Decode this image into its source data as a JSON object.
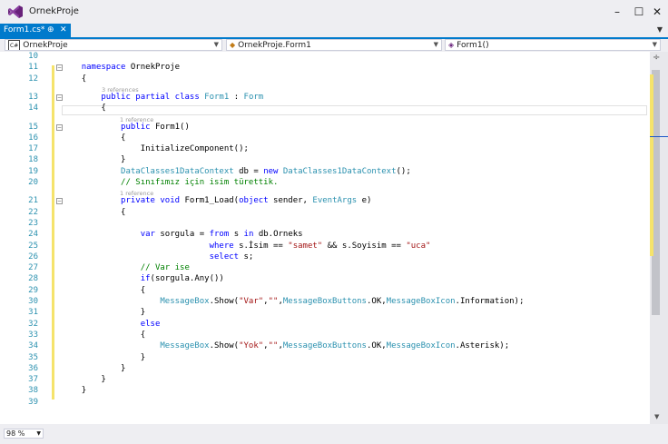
{
  "app": {
    "title": "OrnekProje"
  },
  "window_controls": {
    "minimize": "–",
    "maximize": "☐",
    "close": "✕"
  },
  "tabs": [
    {
      "label": "Form1.cs*",
      "pin": "⊕",
      "close": "✕"
    }
  ],
  "nav": {
    "project": "OrnekProje",
    "class": "OrnekProje.Form1",
    "member": "Form1()"
  },
  "zoom": "98 %",
  "lines": [
    {
      "n": "10",
      "html": ""
    },
    {
      "n": "11",
      "html": "    <span class='kw'>namespace</span> <span class='tx'>OrnekProje</span>"
    },
    {
      "n": "12",
      "html": "    <span class='tx'>{</span>"
    },
    {
      "n": "13",
      "html": "        <span class='kw'>public</span> <span class='kw'>partial</span> <span class='kw'>class</span> <span class='ty'>Form1</span> <span class='tx'>:</span> <span class='ty'>Form</span>"
    },
    {
      "n": "14",
      "html": "        <span class='tx'>{</span>"
    },
    {
      "n": "15",
      "html": "            <span class='kw'>public</span> <span class='tx'>Form1()</span>"
    },
    {
      "n": "16",
      "html": "            <span class='tx'>{</span>"
    },
    {
      "n": "17",
      "html": "                <span class='tx'>InitializeComponent();</span>"
    },
    {
      "n": "18",
      "html": "            <span class='tx'>}</span>"
    },
    {
      "n": "19",
      "html": "            <span class='ty'>DataClasses1DataContext</span> <span class='tx'>db =</span> <span class='kw'>new</span> <span class='ty'>DataClasses1DataContext</span><span class='tx'>();</span>"
    },
    {
      "n": "20",
      "html": "            <span class='cm'>// Sınıfımız için isim türettik.</span>"
    },
    {
      "n": "21",
      "html": "            <span class='kw'>private</span> <span class='kw'>void</span> <span class='tx'>Form1_Load(</span><span class='kw'>object</span> <span class='tx'>sender,</span> <span class='ty'>EventArgs</span> <span class='tx'>e)</span>"
    },
    {
      "n": "22",
      "html": "            <span class='tx'>{</span>"
    },
    {
      "n": "23",
      "html": ""
    },
    {
      "n": "24",
      "html": "                <span class='kw'>var</span> <span class='tx'>sorgula =</span> <span class='kw'>from</span> <span class='tx'>s</span> <span class='kw'>in</span> <span class='tx'>db.Orneks</span>"
    },
    {
      "n": "25",
      "html": "                              <span class='kw'>where</span> <span class='tx'>s.İsim ==</span> <span class='st'>\"samet\"</span> <span class='tx'>&amp;&amp; s.Soyisim ==</span> <span class='st'>\"uca\"</span>"
    },
    {
      "n": "26",
      "html": "                              <span class='kw'>select</span> <span class='tx'>s;</span>"
    },
    {
      "n": "27",
      "html": "                <span class='cm'>// Var ise</span>"
    },
    {
      "n": "28",
      "html": "                <span class='kw'>if</span><span class='tx'>(sorgula.Any())</span>"
    },
    {
      "n": "29",
      "html": "                <span class='tx'>{</span>"
    },
    {
      "n": "30",
      "html": "                    <span class='ty'>MessageBox</span><span class='tx'>.Show(</span><span class='st'>\"Var\"</span><span class='tx'>,</span><span class='st'>\"\"</span><span class='tx'>,</span><span class='ty'>MessageBoxButtons</span><span class='tx'>.OK,</span><span class='ty'>MessageBoxIcon</span><span class='tx'>.Information);</span>"
    },
    {
      "n": "31",
      "html": "                <span class='tx'>}</span>"
    },
    {
      "n": "32",
      "html": "                <span class='kw'>else</span>"
    },
    {
      "n": "33",
      "html": "                <span class='tx'>{</span>"
    },
    {
      "n": "34",
      "html": "                    <span class='ty'>MessageBox</span><span class='tx'>.Show(</span><span class='st'>\"Yok\"</span><span class='tx'>,</span><span class='st'>\"\"</span><span class='tx'>,</span><span class='ty'>MessageBoxButtons</span><span class='tx'>.OK,</span><span class='ty'>MessageBoxIcon</span><span class='tx'>.Asterisk);</span>"
    },
    {
      "n": "35",
      "html": "                <span class='tx'>}</span>"
    },
    {
      "n": "36",
      "html": "            <span class='tx'>}</span>"
    },
    {
      "n": "37",
      "html": "        <span class='tx'>}</span>"
    },
    {
      "n": "38",
      "html": "    <span class='tx'>}</span>"
    },
    {
      "n": "39",
      "html": ""
    }
  ],
  "lenses": [
    {
      "before": "13",
      "text": "3 references"
    },
    {
      "before": "15",
      "text": "1 reference"
    },
    {
      "before": "21",
      "text": "1 reference"
    }
  ]
}
